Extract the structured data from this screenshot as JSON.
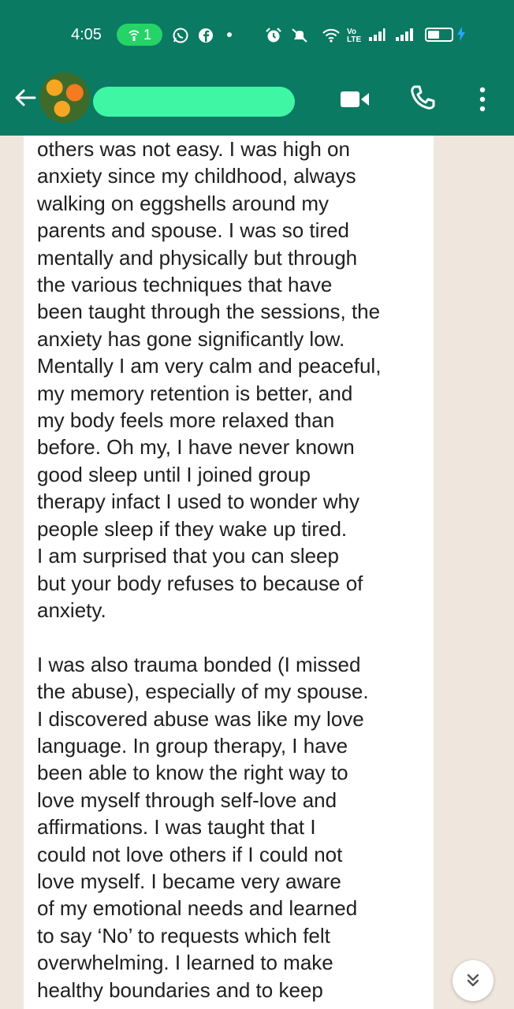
{
  "status_bar": {
    "time": "4:05",
    "hotspot_count": "1",
    "icons": [
      "hotspot-icon",
      "whatsapp-icon",
      "facebook-icon",
      "dot-icon",
      "alarm-icon",
      "mute-icon",
      "wifi-icon",
      "volte-icon",
      "signal-icon",
      "battery-icon",
      "charging-icon"
    ],
    "volte_top": "Vo",
    "volte_bottom": "LTE"
  },
  "app_bar": {
    "background": "#0b7a63",
    "contact_name": "",
    "icons": [
      "back-arrow-icon",
      "video-call-icon",
      "voice-call-icon",
      "more-options-icon"
    ]
  },
  "message": {
    "text": "others was not easy. I was high on\nanxiety since my childhood, always\nwalking on eggshells around my\nparents and spouse. I was so tired\nmentally and physically but through\nthe various techniques that have\nbeen taught through the sessions, the\nanxiety has gone significantly low.\nMentally I am very calm and peaceful,\nmy memory retention is better, and\nmy body feels more relaxed than\nbefore. Oh my, I have never known\ngood sleep until I joined group\ntherapy infact I used to wonder why\npeople sleep if they wake up tired.\nI am surprised that you can sleep\nbut your body refuses to because of\nanxiety.\n\nI was also trauma bonded (I missed\nthe abuse), especially of my spouse.\nI discovered abuse was like my love\nlanguage. In group therapy, I have\nbeen able to know the right way to\nlove myself through self-love and\naffirmations. I was taught that I\ncould not love others if I could not\nlove myself. I became very aware\nof my emotional needs and learned\nto say ‘No’ to requests which felt\noverwhelming. I learned to make\nhealthy boundaries and to keep"
  },
  "scroll_button": {
    "icon": "double-chevron-down-icon",
    "glyph": "»"
  },
  "colors": {
    "header": "#0b7a63",
    "chat_background": "#efe7dd",
    "bubble": "#ffffff",
    "accent_green": "#25d366"
  }
}
